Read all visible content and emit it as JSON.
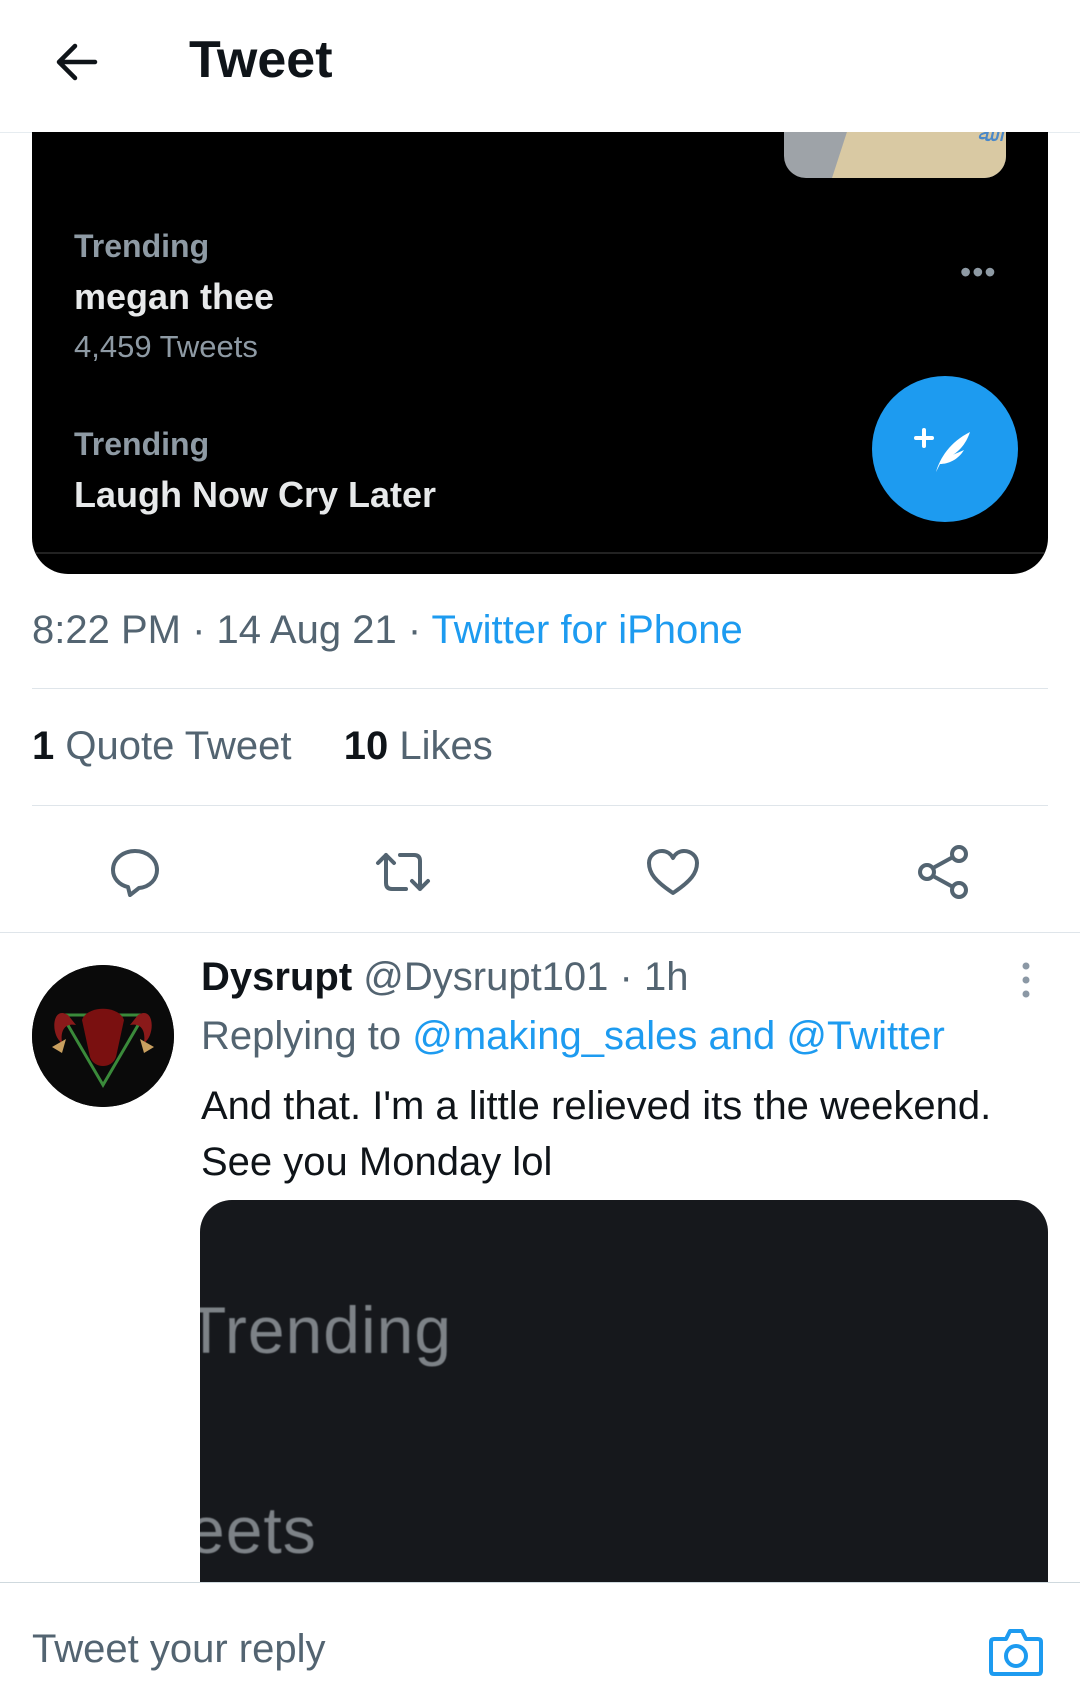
{
  "header": {
    "title": "Tweet"
  },
  "embedded_image": {
    "trends": [
      {
        "label": "Trending",
        "topic": "megan thee",
        "count": "4,459 Tweets"
      },
      {
        "label": "Trending",
        "topic": "Laugh Now Cry Later"
      }
    ],
    "more_icon": "more-horizontal-icon",
    "compose_icon": "compose-feather-icon"
  },
  "tweet_meta": {
    "time": "8:22 PM",
    "sep1": " · ",
    "date": "14 Aug 21",
    "sep2": " · ",
    "source": "Twitter for iPhone"
  },
  "stats": {
    "quote_count": "1",
    "quote_label": "Quote Tweet",
    "likes_count": "10",
    "likes_label": "Likes"
  },
  "actions": [
    "reply-icon",
    "retweet-icon",
    "like-icon",
    "share-icon"
  ],
  "reply": {
    "name": "Dysrupt",
    "handle": "@Dysrupt101",
    "sep": " · ",
    "time": "1h",
    "replying_prefix": "Replying to ",
    "replying_to": "@making_sales and @Twitter",
    "text": "And that. I'm a little relieved its the weekend. See you Monday lol",
    "media_text_1": "Trending",
    "media_text_2": "eets"
  },
  "compose": {
    "placeholder": "Tweet your reply"
  },
  "colors": {
    "accent": "#1d9bf0",
    "text": "#0f1419",
    "muted": "#536471"
  }
}
